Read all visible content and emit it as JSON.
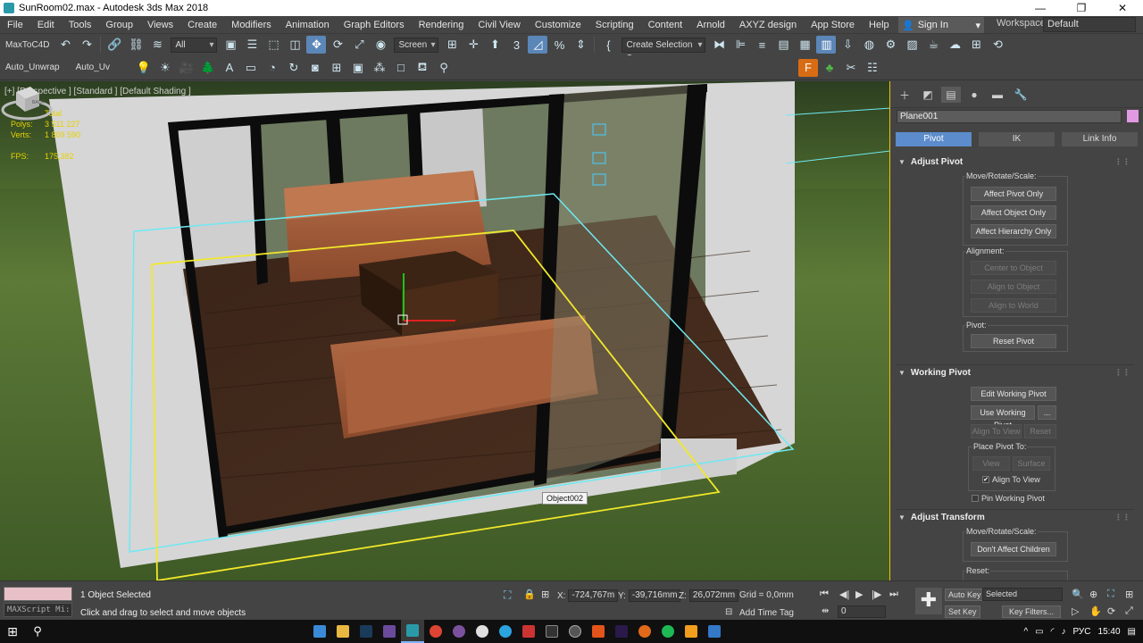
{
  "window": {
    "title": "SunRoom02.max - Autodesk 3ds Max 2018",
    "buttons": [
      "—",
      "❐",
      "✕"
    ]
  },
  "menu": {
    "items": [
      "File",
      "Edit",
      "Tools",
      "Group",
      "Views",
      "Create",
      "Modifiers",
      "Animation",
      "Graph Editors",
      "Rendering",
      "Civil View",
      "Customize",
      "Scripting",
      "Content",
      "Arnold",
      "AXYZ design",
      "App Store",
      "Help"
    ],
    "sign_in": "Sign In",
    "workspaces_label": "Workspaces:",
    "workspaces_value": "Default"
  },
  "toolbar1": {
    "maxtoc4d": "MaxToC4D",
    "filter_all": "All",
    "ref_coord": "Screen",
    "selection_set": "Create Selection Se"
  },
  "toolbar2": {
    "auto_unwrap": "Auto_Unwrap",
    "auto_uv": "Auto_Uv"
  },
  "viewport": {
    "label": "[+] [Perspective ] [Standard ] [Default Shading ]",
    "stats": {
      "total": "Total",
      "polys_label": "Polys:",
      "polys": "3 511 227",
      "verts_label": "Verts:",
      "verts": "1 809 590",
      "fps_label": "FPS:",
      "fps": "175,382"
    },
    "tooltip": "Object002",
    "viewcube": "BACK"
  },
  "command_panel": {
    "object_name": "Plane001",
    "object_color": "#e19ae1",
    "tabs": [
      "Pivot",
      "IK",
      "Link Info"
    ],
    "adjust_pivot": {
      "title": "Adjust Pivot",
      "move_label": "Move/Rotate/Scale:",
      "affect_pivot": "Affect Pivot Only",
      "affect_object": "Affect Object Only",
      "affect_hierarchy": "Affect Hierarchy Only",
      "alignment_label": "Alignment:",
      "center_to_object": "Center to Object",
      "align_to_object": "Align to Object",
      "align_to_world": "Align to World",
      "pivot_label": "Pivot:",
      "reset_pivot": "Reset Pivot"
    },
    "working_pivot": {
      "title": "Working Pivot",
      "edit": "Edit Working Pivot",
      "use": "Use Working Pivot",
      "more": "...",
      "align_to_view": "Align To View",
      "reset": "Reset",
      "place_label": "Place Pivot To:",
      "view": "View",
      "surface": "Surface",
      "align_to_view_chk": "Align To View",
      "pin": "Pin Working Pivot"
    },
    "adjust_transform": {
      "title": "Adjust Transform",
      "move_label": "Move/Rotate/Scale:",
      "dont_affect": "Don't Affect Children",
      "reset_label": "Reset:"
    }
  },
  "status": {
    "maxscript": "MAXScript Mi:",
    "selected": "1 Object Selected",
    "prompt": "Click and drag to select and move objects",
    "x_label": "X:",
    "x": "-724,767m",
    "y_label": "Y:",
    "y": "-39,716mm",
    "z_label": "Z:",
    "z": "26,072mm",
    "grid": "Grid = 0,0mm",
    "add_time_tag": "Add Time Tag",
    "frame": "0",
    "auto_key": "Auto Key",
    "set_key": "Set Key",
    "selected_dropdown": "Selected",
    "key_filters": "Key Filters..."
  },
  "taskbar": {
    "lang": "РУС",
    "time": "15:40"
  }
}
